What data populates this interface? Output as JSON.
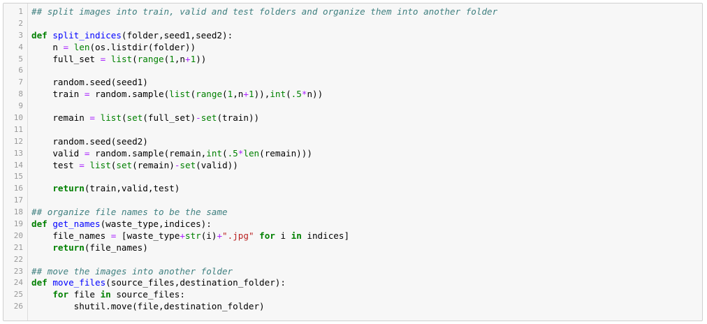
{
  "lines": [
    {
      "n": "1",
      "tokens": [
        {
          "t": "comment",
          "v": "## split images into train, valid and test folders and organize them into another folder"
        }
      ]
    },
    {
      "n": "2",
      "tokens": []
    },
    {
      "n": "3",
      "tokens": [
        {
          "t": "keyword",
          "v": "def"
        },
        {
          "t": "punct",
          "v": " "
        },
        {
          "t": "def",
          "v": "split_indices"
        },
        {
          "t": "punct",
          "v": "(folder,seed1,seed2):"
        }
      ]
    },
    {
      "n": "4",
      "tokens": [
        {
          "t": "indent",
          "v": "    "
        },
        {
          "t": "name",
          "v": "n "
        },
        {
          "t": "operator",
          "v": "="
        },
        {
          "t": "punct",
          "v": " "
        },
        {
          "t": "builtin",
          "v": "len"
        },
        {
          "t": "punct",
          "v": "(os.listdir(folder))"
        }
      ]
    },
    {
      "n": "5",
      "tokens": [
        {
          "t": "indent",
          "v": "    "
        },
        {
          "t": "name",
          "v": "full_set "
        },
        {
          "t": "operator",
          "v": "="
        },
        {
          "t": "punct",
          "v": " "
        },
        {
          "t": "builtin",
          "v": "list"
        },
        {
          "t": "punct",
          "v": "("
        },
        {
          "t": "builtin",
          "v": "range"
        },
        {
          "t": "punct",
          "v": "("
        },
        {
          "t": "number",
          "v": "1"
        },
        {
          "t": "punct",
          "v": ",n"
        },
        {
          "t": "operator",
          "v": "+"
        },
        {
          "t": "number",
          "v": "1"
        },
        {
          "t": "punct",
          "v": "))"
        }
      ]
    },
    {
      "n": "6",
      "tokens": []
    },
    {
      "n": "7",
      "tokens": [
        {
          "t": "indent",
          "v": "    "
        },
        {
          "t": "name",
          "v": "random.seed(seed1)"
        }
      ]
    },
    {
      "n": "8",
      "tokens": [
        {
          "t": "indent",
          "v": "    "
        },
        {
          "t": "name",
          "v": "train "
        },
        {
          "t": "operator",
          "v": "="
        },
        {
          "t": "punct",
          "v": " random.sample("
        },
        {
          "t": "builtin",
          "v": "list"
        },
        {
          "t": "punct",
          "v": "("
        },
        {
          "t": "builtin",
          "v": "range"
        },
        {
          "t": "punct",
          "v": "("
        },
        {
          "t": "number",
          "v": "1"
        },
        {
          "t": "punct",
          "v": ",n"
        },
        {
          "t": "operator",
          "v": "+"
        },
        {
          "t": "number",
          "v": "1"
        },
        {
          "t": "punct",
          "v": ")),"
        },
        {
          "t": "builtin",
          "v": "int"
        },
        {
          "t": "punct",
          "v": "("
        },
        {
          "t": "number",
          "v": ".5"
        },
        {
          "t": "operator",
          "v": "*"
        },
        {
          "t": "punct",
          "v": "n))"
        }
      ]
    },
    {
      "n": "9",
      "tokens": []
    },
    {
      "n": "10",
      "tokens": [
        {
          "t": "indent",
          "v": "    "
        },
        {
          "t": "name",
          "v": "remain "
        },
        {
          "t": "operator",
          "v": "="
        },
        {
          "t": "punct",
          "v": " "
        },
        {
          "t": "builtin",
          "v": "list"
        },
        {
          "t": "punct",
          "v": "("
        },
        {
          "t": "builtin",
          "v": "set"
        },
        {
          "t": "punct",
          "v": "(full_set)"
        },
        {
          "t": "operator",
          "v": "-"
        },
        {
          "t": "builtin",
          "v": "set"
        },
        {
          "t": "punct",
          "v": "(train))"
        }
      ]
    },
    {
      "n": "11",
      "tokens": []
    },
    {
      "n": "12",
      "tokens": [
        {
          "t": "indent",
          "v": "    "
        },
        {
          "t": "name",
          "v": "random.seed(seed2)"
        }
      ]
    },
    {
      "n": "13",
      "tokens": [
        {
          "t": "indent",
          "v": "    "
        },
        {
          "t": "name",
          "v": "valid "
        },
        {
          "t": "operator",
          "v": "="
        },
        {
          "t": "punct",
          "v": " random.sample(remain,"
        },
        {
          "t": "builtin",
          "v": "int"
        },
        {
          "t": "punct",
          "v": "("
        },
        {
          "t": "number",
          "v": ".5"
        },
        {
          "t": "operator",
          "v": "*"
        },
        {
          "t": "builtin",
          "v": "len"
        },
        {
          "t": "punct",
          "v": "(remain)))"
        }
      ]
    },
    {
      "n": "14",
      "tokens": [
        {
          "t": "indent",
          "v": "    "
        },
        {
          "t": "name",
          "v": "test "
        },
        {
          "t": "operator",
          "v": "="
        },
        {
          "t": "punct",
          "v": " "
        },
        {
          "t": "builtin",
          "v": "list"
        },
        {
          "t": "punct",
          "v": "("
        },
        {
          "t": "builtin",
          "v": "set"
        },
        {
          "t": "punct",
          "v": "(remain)"
        },
        {
          "t": "operator",
          "v": "-"
        },
        {
          "t": "builtin",
          "v": "set"
        },
        {
          "t": "punct",
          "v": "(valid))"
        }
      ]
    },
    {
      "n": "15",
      "tokens": []
    },
    {
      "n": "16",
      "tokens": [
        {
          "t": "indent",
          "v": "    "
        },
        {
          "t": "keyword",
          "v": "return"
        },
        {
          "t": "punct",
          "v": "(train,valid,test)"
        }
      ]
    },
    {
      "n": "17",
      "tokens": []
    },
    {
      "n": "18",
      "tokens": [
        {
          "t": "comment",
          "v": "## organize file names to be the same"
        }
      ]
    },
    {
      "n": "19",
      "tokens": [
        {
          "t": "keyword",
          "v": "def"
        },
        {
          "t": "punct",
          "v": " "
        },
        {
          "t": "def",
          "v": "get_names"
        },
        {
          "t": "punct",
          "v": "(waste_type,indices):"
        }
      ]
    },
    {
      "n": "20",
      "tokens": [
        {
          "t": "indent",
          "v": "    "
        },
        {
          "t": "name",
          "v": "file_names "
        },
        {
          "t": "operator",
          "v": "="
        },
        {
          "t": "punct",
          "v": " [waste_type"
        },
        {
          "t": "operator",
          "v": "+"
        },
        {
          "t": "builtin",
          "v": "str"
        },
        {
          "t": "punct",
          "v": "(i)"
        },
        {
          "t": "operator",
          "v": "+"
        },
        {
          "t": "string",
          "v": "\".jpg\""
        },
        {
          "t": "punct",
          "v": " "
        },
        {
          "t": "keyword",
          "v": "for"
        },
        {
          "t": "punct",
          "v": " i "
        },
        {
          "t": "keyword",
          "v": "in"
        },
        {
          "t": "punct",
          "v": " indices]"
        }
      ]
    },
    {
      "n": "21",
      "tokens": [
        {
          "t": "indent",
          "v": "    "
        },
        {
          "t": "keyword",
          "v": "return"
        },
        {
          "t": "punct",
          "v": "(file_names)"
        }
      ]
    },
    {
      "n": "22",
      "tokens": []
    },
    {
      "n": "23",
      "tokens": [
        {
          "t": "comment",
          "v": "## move the images into another folder"
        }
      ]
    },
    {
      "n": "24",
      "tokens": [
        {
          "t": "keyword",
          "v": "def"
        },
        {
          "t": "punct",
          "v": " "
        },
        {
          "t": "def",
          "v": "move_files"
        },
        {
          "t": "punct",
          "v": "(source_files,destination_folder):"
        }
      ]
    },
    {
      "n": "25",
      "tokens": [
        {
          "t": "indent",
          "v": "    "
        },
        {
          "t": "keyword",
          "v": "for"
        },
        {
          "t": "punct",
          "v": " file "
        },
        {
          "t": "keyword",
          "v": "in"
        },
        {
          "t": "punct",
          "v": " source_files:"
        }
      ]
    },
    {
      "n": "26",
      "tokens": [
        {
          "t": "indent",
          "v": "        "
        },
        {
          "t": "name",
          "v": "shutil.move(file,destination_folder)"
        }
      ]
    }
  ]
}
